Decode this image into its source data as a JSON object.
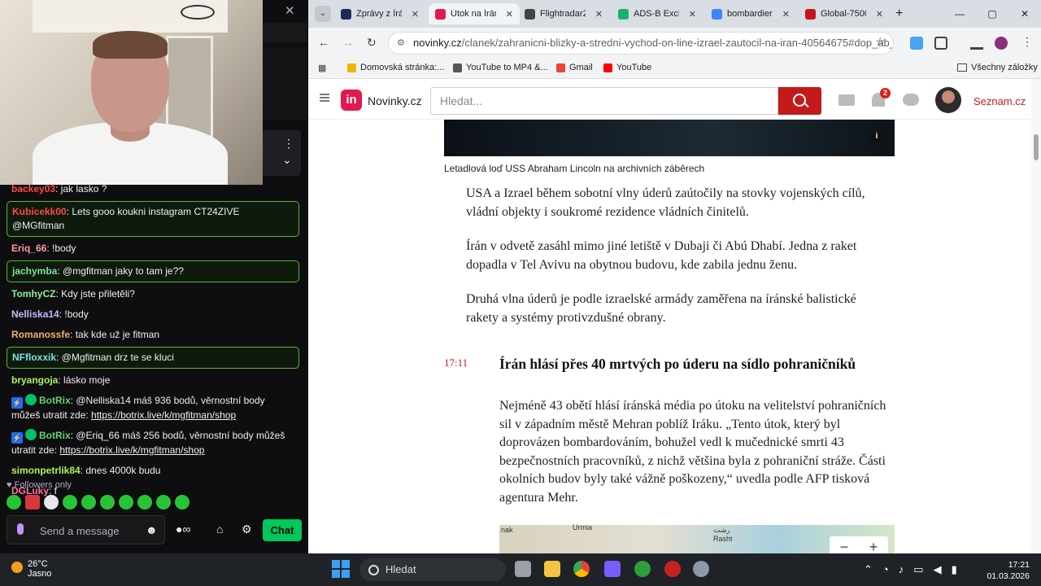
{
  "stream": {
    "close_glyph": "✕",
    "menu_glyph": "⋮",
    "collapse_glyph": "⌄"
  },
  "chat": {
    "messages": [
      {
        "user": "backey03",
        "text": ": jak lasko ?",
        "color": "#ff4a4a",
        "highlight": false,
        "bot": false,
        "link": ""
      },
      {
        "user": "Kubicekk00",
        "text": ": Lets gooo koukni instagram CT24ZIVE @MGfitman",
        "color": "#ff4a4a",
        "highlight": true,
        "bot": false,
        "link": ""
      },
      {
        "user": "Eriq_66",
        "text": ": !body",
        "color": "#ff9aa2",
        "highlight": false,
        "bot": false,
        "link": ""
      },
      {
        "user": "jachymba",
        "text": ": @mgfitman jaky to tam je??",
        "color": "#7fe0a0",
        "highlight": true,
        "bot": false,
        "link": ""
      },
      {
        "user": "TomhyCZ",
        "text": ": Kdy jste přiletěli?",
        "color": "#8ef08e",
        "highlight": false,
        "bot": false,
        "link": ""
      },
      {
        "user": "Nelliska14",
        "text": ": !body",
        "color": "#c9b6ff",
        "highlight": false,
        "bot": false,
        "link": ""
      },
      {
        "user": "Romanossfe",
        "text": ": tak kde už je fitman",
        "color": "#f0b070",
        "highlight": false,
        "bot": false,
        "link": ""
      },
      {
        "user": "NFfloxxik",
        "text": ": @Mgfitman drz te se kluci",
        "color": "#7fe0e0",
        "highlight": true,
        "bot": false,
        "link": ""
      },
      {
        "user": "bryangoja",
        "text": ": lásko moje",
        "color": "#b0f060",
        "highlight": false,
        "bot": false,
        "link": ""
      },
      {
        "user": "BotRix",
        "text": ": @Nelliska14 máš 936 bodů, věrnostní body můžeš utratit zde: ",
        "color": "#63d471",
        "highlight": false,
        "bot": true,
        "link": "https://botrix.live/k/mgfitman/shop"
      },
      {
        "user": "BotRix",
        "text": ": @Eriq_66 máš 256 bodů, věrnostní body můžeš utratit zde: ",
        "color": "#63d471",
        "highlight": false,
        "bot": true,
        "link": "https://botrix.live/k/mgfitman/shop"
      },
      {
        "user": "simonpetrlik84",
        "text": ": dnes 4000k budu",
        "color": "#b0f060",
        "highlight": false,
        "bot": false,
        "link": ""
      },
      {
        "user": "DGLuky",
        "text": ": f",
        "color": "#ff6fa8",
        "highlight": false,
        "bot": false,
        "link": ""
      }
    ],
    "followers_only": "Followers only",
    "message_placeholder": "Send a message",
    "chat_button": "Chat"
  },
  "browser": {
    "tabs": [
      {
        "title": "Zprávy z Írán",
        "favicon_color": "#1e2a5a",
        "active": false
      },
      {
        "title": "Útok na Írán",
        "favicon_color": "#e01a4f",
        "active": true
      },
      {
        "title": "Flightradar2",
        "favicon_color": "#444444",
        "active": false
      },
      {
        "title": "ADS-B Exch",
        "favicon_color": "#19b36b",
        "active": false
      },
      {
        "title": "bombardier",
        "favicon_color": "#4285f4",
        "active": false
      },
      {
        "title": "Global-7500",
        "favicon_color": "#c4161c",
        "active": false
      }
    ],
    "new_tab_glyph": "+",
    "url_host": "novinky.cz",
    "url_path": "/clanek/zahranicni-blizky-a-stredni-vychod-on-line-izrael-zautocil-na-iran-40564675#dop_ab_va...",
    "bookmarks": [
      {
        "label": "Domovská stránka:...",
        "color": "#f4b400"
      },
      {
        "label": "YouTube to MP4 &...",
        "color": "#555555"
      },
      {
        "label": "Gmail",
        "color": "#ea4335"
      },
      {
        "label": "YouTube",
        "color": "#ff0000"
      }
    ],
    "all_bookmarks": "Všechny záložky"
  },
  "site": {
    "logo_text": "in",
    "brand": "Novinky.cz",
    "search_placeholder": "Hledat...",
    "notification_count": "2",
    "seznam_link": "Seznam.cz"
  },
  "article": {
    "caption": "Letadlová loď USS Abraham Lincoln na archivních záběrech",
    "paragraphs": [
      "USA a Izrael během sobotní vlny úderů zaútočily na stovky vojenských cílů, vládní objekty i soukromé rezidence vládních činitelů.",
      "Írán v odvetě zasáhl mimo jiné letiště v Dubaji či Abú Dhabí. Jedna z raket dopadla v Tel Avivu na obytnou budovu, kde zabila jednu ženu.",
      "Druhá vlna úderů je podle izraelské armády zaměřena na íránské balistické rakety a systémy protivzdušné obrany."
    ],
    "update_time": "17:11",
    "update_headline": "Írán hlásí přes 40 mrtvých po úderu na sídlo pohraničníků",
    "update_body": "Nejméně 43 obětí hlásí íránská média po útoku na velitelství pohraničních sil v západním městě Mehran poblíž Iráku. „Tento útok, který byl doprovázen bombardováním, bohužel vedl k mučednické smrti 43 bezpečnostních pracovníků, z nichž většina byla z pohraniční stráže. Části okolních budov byly také vážně poškozeny,“ uvedla podle AFP tisková agentura Mehr.",
    "map_labels": [
      "nak",
      "Urmia",
      "Rasht",
      "رشت"
    ],
    "zoom_out": "−",
    "zoom_in": "+"
  },
  "taskbar": {
    "temperature": "26°C",
    "weather": "Jasno",
    "search": "Hledat",
    "time": "17:21",
    "date": "01.03.2026"
  }
}
